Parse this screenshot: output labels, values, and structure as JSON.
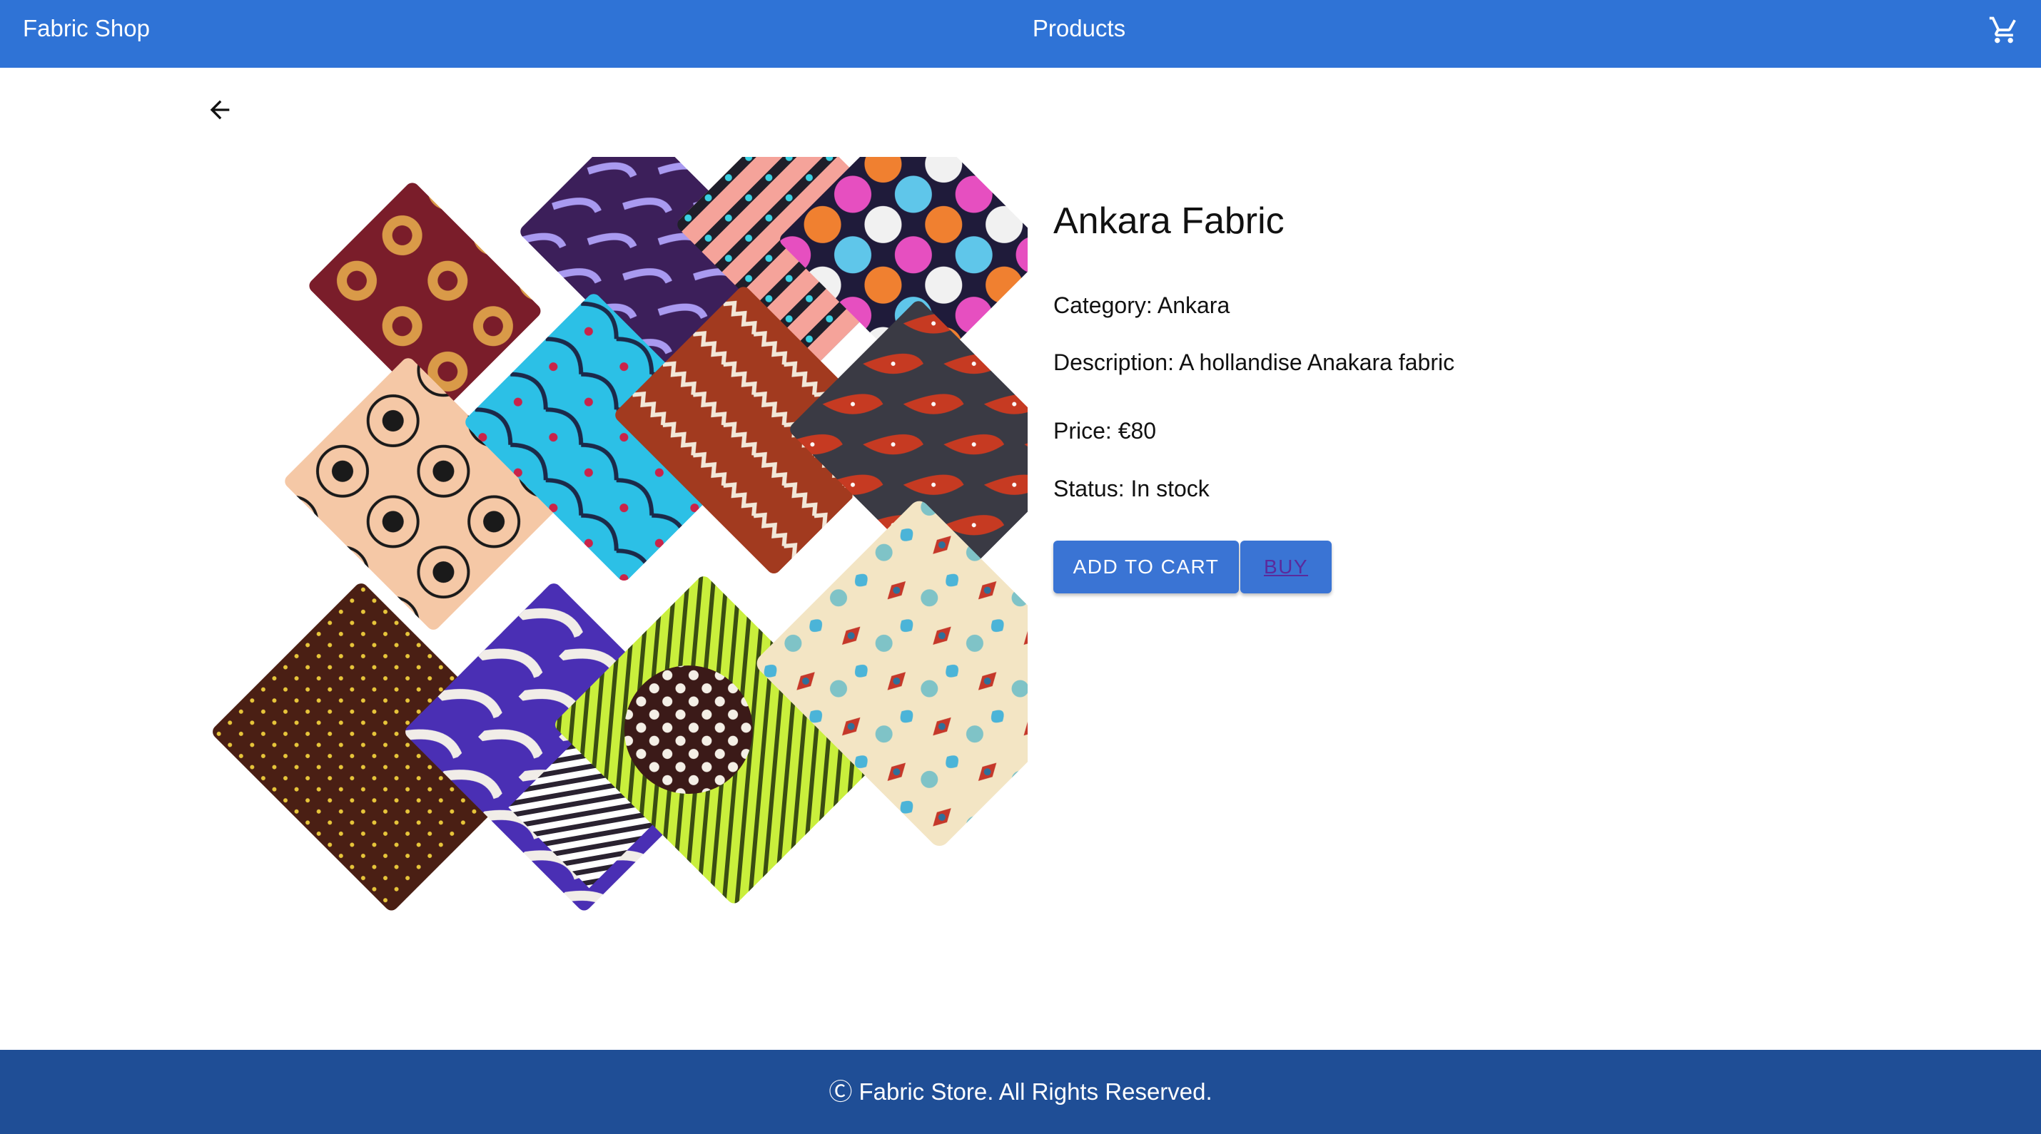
{
  "header": {
    "brand": "Fabric Shop",
    "nav_title": "Products",
    "cart_icon": "shopping-cart-icon"
  },
  "back_icon": "arrow-left-icon",
  "product": {
    "image_icon": "fabric-product-image",
    "title": "Ankara Fabric",
    "category": "Category: Ankara",
    "description": "Description: A hollandise Anakara fabric",
    "price": "Price: €80",
    "status": "Status: In stock",
    "add_to_cart_label": "ADD TO CART",
    "buy_label": "BUY"
  },
  "footer": {
    "text": "Ⓒ Fabric Store. All Rights Reserved."
  },
  "colors": {
    "header_bg": "#2f73d6",
    "footer_bg": "#1f4e96",
    "button_bg": "#3a74d4",
    "buy_text": "#5b2a9c"
  }
}
